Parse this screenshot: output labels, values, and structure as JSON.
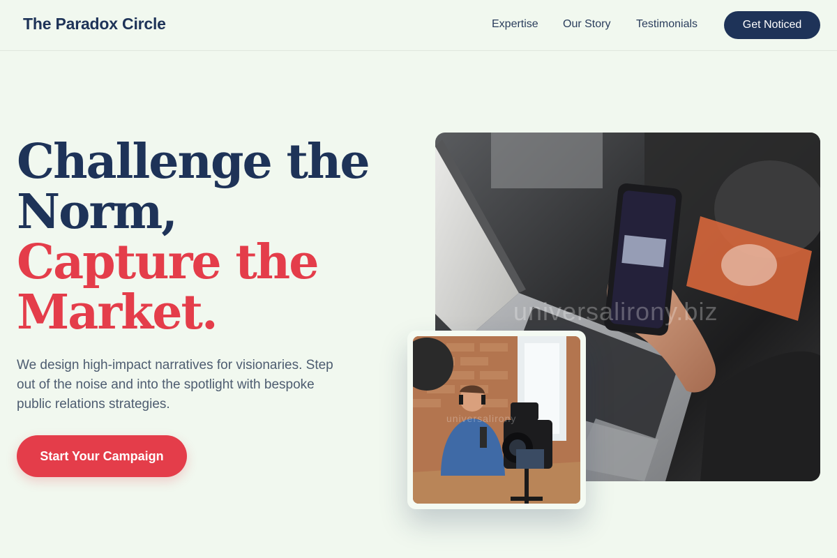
{
  "nav": {
    "brand": "The Paradox Circle",
    "links": [
      "Expertise",
      "Our Story",
      "Testimonials"
    ],
    "cta": "Get Noticed"
  },
  "hero": {
    "headline_dark_1": "Challenge the",
    "headline_dark_2": "Norm,",
    "headline_red_1": "Capture the",
    "headline_red_2": "Market.",
    "subtext": "We design high-impact narratives for visionaries. Step out of the noise and into the spotlight with bespoke public relations strategies.",
    "cta": "Start Your Campaign"
  },
  "images": {
    "main_watermark": "universalirony.biz",
    "inset_watermark": "universalirony"
  },
  "colors": {
    "background": "#f1f8ef",
    "navy": "#1e3358",
    "accent_red": "#e43d4a"
  }
}
